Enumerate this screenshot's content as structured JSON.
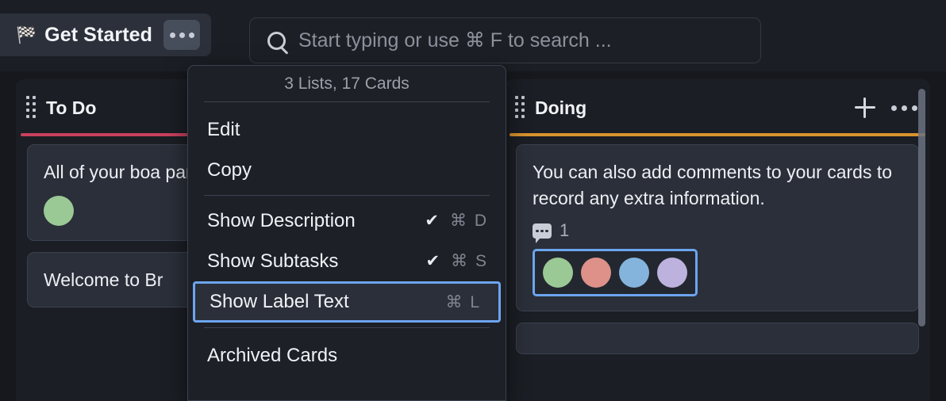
{
  "board": {
    "icon": "checkered-flag-icon",
    "icon_glyph": "🏁",
    "title": "Get Started",
    "menu_button": "board-options"
  },
  "search": {
    "placeholder": "Start typing or use ⌘ F to search ...",
    "value": "",
    "icon": "search-icon"
  },
  "menu": {
    "header": "3 Lists, 17 Cards",
    "items": [
      {
        "label": "Edit",
        "shortcut": "",
        "checked": false,
        "selected": false
      },
      {
        "label": "Copy",
        "shortcut": "",
        "checked": false,
        "selected": false
      },
      {
        "label": "Show Description",
        "shortcut": "⌘ D",
        "checked": true,
        "selected": false
      },
      {
        "label": "Show Subtasks",
        "shortcut": "⌘ S",
        "checked": true,
        "selected": false
      },
      {
        "label": "Show Label Text",
        "shortcut": "⌘ L",
        "checked": false,
        "selected": true
      },
      {
        "label": "Archived Cards",
        "shortcut": "",
        "checked": false,
        "selected": false
      }
    ],
    "check_glyph": "✔",
    "highlight_color": "#6CA5F0"
  },
  "lists": [
    {
      "title": "To Do",
      "accent_color": "#C9405E",
      "cards": [
        {
          "text": "All of your boa panel and all y right.",
          "comments": null,
          "labels": [
            "#9BC995"
          ],
          "labels_boxed": false
        },
        {
          "text": "Welcome to Br",
          "comments": null,
          "labels": [],
          "labels_boxed": false
        }
      ]
    },
    {
      "title": "Doing",
      "accent_color": "#D9922E",
      "cards": [
        {
          "text": "You can also add comments to your cards to record any extra information.",
          "comments": "1",
          "labels": [
            "#9BC995",
            "#DD9189",
            "#84B4DC",
            "#BDB2DE"
          ],
          "labels_boxed": true
        },
        {
          "text": "",
          "comments": null,
          "labels": [],
          "labels_boxed": false
        }
      ]
    }
  ],
  "colors": {
    "page_background": "#16181D",
    "list_background": "#1B1E24",
    "card_background": "#2A2F39",
    "accent_blue": "#6CA5F0"
  }
}
